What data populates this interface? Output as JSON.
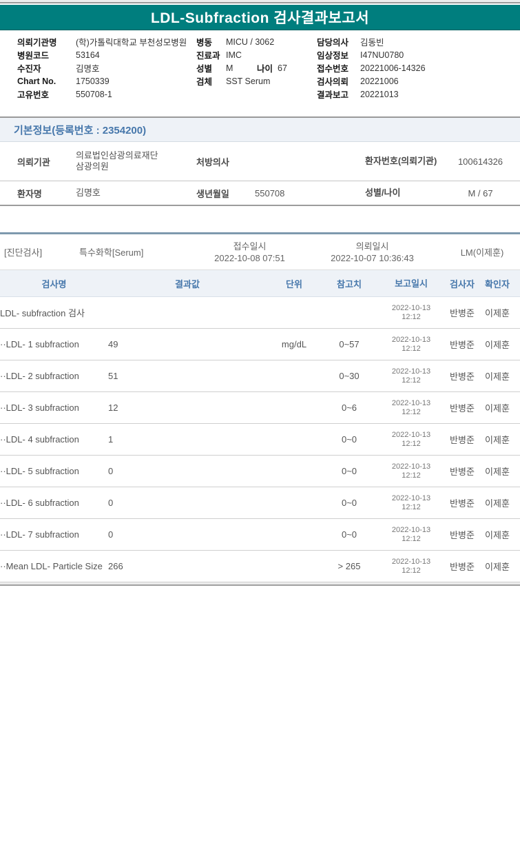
{
  "colors": {
    "header_teal": "#007E7E",
    "accent_blue": "#4677AB"
  },
  "title_bar": {
    "title": "LDL-Subfraction 검사결과보고서"
  },
  "patient_info": {
    "col1": [
      {
        "label": "의뢰기관명",
        "value": "(학)가톨릭대학교 부천성모병원"
      },
      {
        "label": "병원코드",
        "value": "53164"
      },
      {
        "label": "수진자",
        "value": "김명호"
      },
      {
        "label": "Chart No.",
        "value": "1750339"
      },
      {
        "label": "고유번호",
        "value": "550708-1"
      }
    ],
    "col2": [
      {
        "label": "병동",
        "value": "MICU / 3062"
      },
      {
        "label": "진료과",
        "value": "IMC"
      },
      {
        "label": "성별",
        "value": "M",
        "label2": "나이",
        "value2": "67"
      },
      {
        "label": "검체",
        "value": "SST Serum"
      }
    ],
    "col3": [
      {
        "label": "담당의사",
        "value": "김동빈"
      },
      {
        "label": "임상정보",
        "value": "I47NU0780"
      },
      {
        "label": "접수번호",
        "value": "20221006-14326"
      },
      {
        "label": "검사의뢰",
        "value": "20221006"
      },
      {
        "label": "결과보고",
        "value": "20221013"
      }
    ]
  },
  "basic_info": {
    "header": "기본정보(등록번호 : 2354200)",
    "rows": [
      [
        {
          "label": "의뢰기관",
          "value": "의료법인삼광의료재단삼광의원"
        },
        {
          "label": "처방의사",
          "value": ""
        },
        {
          "label": "환자번호(의뢰기관)",
          "value": "100614326"
        }
      ],
      [
        {
          "label": "환자명",
          "value": "김명호"
        },
        {
          "label": "생년월일",
          "value": "550708"
        },
        {
          "label": "성별/나이",
          "value": "M / 67"
        }
      ]
    ]
  },
  "section": {
    "dept": "[진단검사]",
    "category": "특수화학[Serum]",
    "receipt_label": "접수일시",
    "receipt_time": "2022-10-08 07:51",
    "request_label": "의뢰일시",
    "request_time": "2022-10-07 10:36:43",
    "reader": "LM(이제훈)"
  },
  "results_table": {
    "headers": [
      "검사명",
      "결과값",
      "단위",
      "참고치",
      "보고일시",
      "검사자",
      "확인자"
    ],
    "rows": [
      {
        "name": "LDL- subfraction 검사",
        "result": "",
        "unit": "",
        "ref": "",
        "date": "2022-10-13",
        "time": "12:12",
        "tester": "반병준",
        "confirmer": "이제훈"
      },
      {
        "name": "··LDL- 1 subfraction",
        "result": "49",
        "unit": "mg/dL",
        "ref": "0~57",
        "date": "2022-10-13",
        "time": "12:12",
        "tester": "반병준",
        "confirmer": "이제훈"
      },
      {
        "name": "··LDL- 2 subfraction",
        "result": "51",
        "unit": "",
        "ref": "0~30",
        "date": "2022-10-13",
        "time": "12:12",
        "tester": "반병준",
        "confirmer": "이제훈"
      },
      {
        "name": "··LDL- 3 subfraction",
        "result": "12",
        "unit": "",
        "ref": "0~6",
        "date": "2022-10-13",
        "time": "12:12",
        "tester": "반병준",
        "confirmer": "이제훈"
      },
      {
        "name": "··LDL- 4 subfraction",
        "result": "1",
        "unit": "",
        "ref": "0~0",
        "date": "2022-10-13",
        "time": "12:12",
        "tester": "반병준",
        "confirmer": "이제훈"
      },
      {
        "name": "··LDL- 5 subfraction",
        "result": "0",
        "unit": "",
        "ref": "0~0",
        "date": "2022-10-13",
        "time": "12:12",
        "tester": "반병준",
        "confirmer": "이제훈"
      },
      {
        "name": "··LDL- 6 subfraction",
        "result": "0",
        "unit": "",
        "ref": "0~0",
        "date": "2022-10-13",
        "time": "12:12",
        "tester": "반병준",
        "confirmer": "이제훈"
      },
      {
        "name": "··LDL- 7 subfraction",
        "result": "0",
        "unit": "",
        "ref": "0~0",
        "date": "2022-10-13",
        "time": "12:12",
        "tester": "반병준",
        "confirmer": "이제훈"
      },
      {
        "name": "··Mean LDL- Particle Size",
        "result": "266",
        "unit": "",
        "ref": "> 265",
        "date": "2022-10-13",
        "time": "12:12",
        "tester": "반병준",
        "confirmer": "이제훈"
      }
    ]
  }
}
